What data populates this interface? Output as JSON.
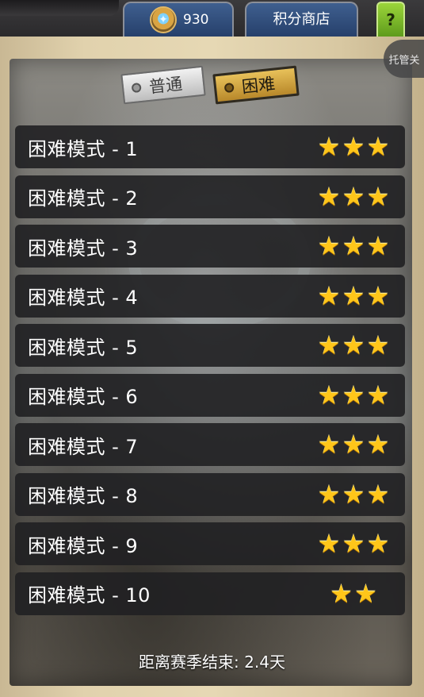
{
  "top_bar": {
    "currency_value": "930",
    "shop_label": "积分商店",
    "help_label": "?"
  },
  "auto_label": "托管关",
  "tabs": [
    {
      "label": "普通",
      "selected": false
    },
    {
      "label": "困难",
      "selected": true
    }
  ],
  "levels": [
    {
      "label": "困难模式 - 1",
      "stars": 3
    },
    {
      "label": "困难模式 - 2",
      "stars": 3
    },
    {
      "label": "困难模式 - 3",
      "stars": 3
    },
    {
      "label": "困难模式 - 4",
      "stars": 3
    },
    {
      "label": "困难模式 - 5",
      "stars": 3
    },
    {
      "label": "困难模式 - 6",
      "stars": 3
    },
    {
      "label": "困难模式 - 7",
      "stars": 3
    },
    {
      "label": "困难模式 - 8",
      "stars": 3
    },
    {
      "label": "困难模式 - 9",
      "stars": 3
    },
    {
      "label": "困难模式 - 10",
      "stars": 2
    }
  ],
  "season_text": "距离赛季结束: 2.4天",
  "colors": {
    "star": "#ffc61a",
    "row_bg": "#202022",
    "tab_hard": "#d4a23e",
    "top_button": "#34507d",
    "help_button": "#8cc63f"
  }
}
